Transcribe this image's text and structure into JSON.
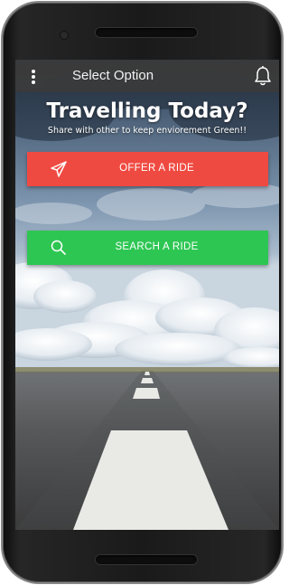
{
  "appbar": {
    "title": "Select Option",
    "menu_icon": "more-vertical-icon",
    "notification_icon": "bell-icon",
    "background": "#3a3a3a"
  },
  "hero": {
    "title": "Travelling Today?",
    "subtitle": "Share with other to keep enviorement Green!!"
  },
  "actions": {
    "offer": {
      "label": "OFFER A RIDE",
      "icon": "paper-plane-icon",
      "color": "#ef4a41"
    },
    "search": {
      "label": "SEARCH A RIDE",
      "icon": "search-icon",
      "color": "#2dc653"
    }
  }
}
